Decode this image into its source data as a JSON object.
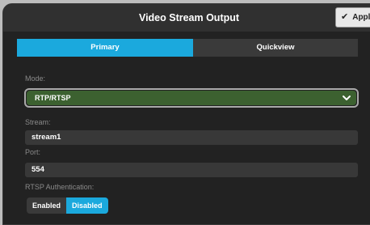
{
  "window": {
    "title": "Video Stream Output",
    "apply_label": "Apply"
  },
  "tabs": [
    {
      "label": "Primary",
      "active": true
    },
    {
      "label": "Quickview",
      "active": false
    }
  ],
  "mode": {
    "label": "Mode:",
    "value": "RTP/RTSP"
  },
  "stream": {
    "label": "Stream:",
    "value": "stream1"
  },
  "port": {
    "label": "Port:",
    "value": "554"
  },
  "rtsp_auth": {
    "label": "RTSP Authentication:",
    "options": [
      "Enabled",
      "Disabled"
    ],
    "selected": "Disabled"
  },
  "colors": {
    "accent": "#1ba9dd",
    "select_bg": "#3c6130",
    "panel_bg": "#222222"
  }
}
